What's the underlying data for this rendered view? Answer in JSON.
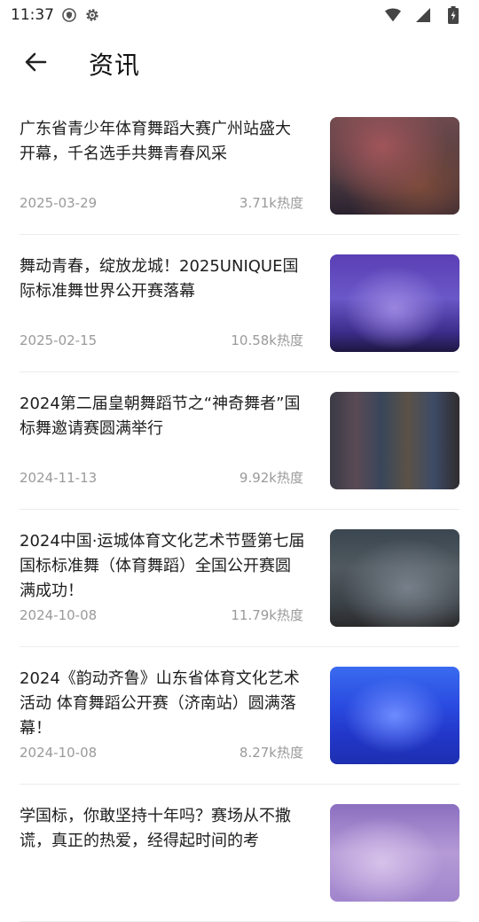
{
  "status_bar": {
    "time": "11:37",
    "icons": [
      "shield-icon",
      "gear-icon",
      "wifi-icon",
      "signal-icon",
      "battery-icon"
    ]
  },
  "app_bar": {
    "back_icon": "arrow-left-icon",
    "title": "资讯"
  },
  "news": [
    {
      "title": "广东省青少年体育舞蹈大赛广州站盛大开幕，千名选手共舞青春风采",
      "date": "2025-03-29",
      "heat": "3.71k热度"
    },
    {
      "title": "舞动青春，绽放龙城！2025UNIQUE国际标准舞世界公开赛落幕",
      "date": "2025-02-15",
      "heat": "10.58k热度"
    },
    {
      "title": "2024第二届皇朝舞蹈节之“神奇舞者”国标舞邀请赛圆满举行",
      "date": "2024-11-13",
      "heat": "9.92k热度"
    },
    {
      "title": "2024中国·运城体育文化艺术节暨第七届国标标准舞（体育舞蹈）全国公开赛圆满成功！",
      "date": "2024-10-08",
      "heat": "11.79k热度"
    },
    {
      "title": "2024《韵动齐鲁》山东省体育文化艺术活动 体育舞蹈公开赛（济南站）圆满落幕！",
      "date": "2024-10-08",
      "heat": "8.27k热度"
    },
    {
      "title": "学国标，你敢坚持十年吗？赛场从不撒谎，真正的热爱，经得起时间的考",
      "date": "",
      "heat": ""
    }
  ]
}
